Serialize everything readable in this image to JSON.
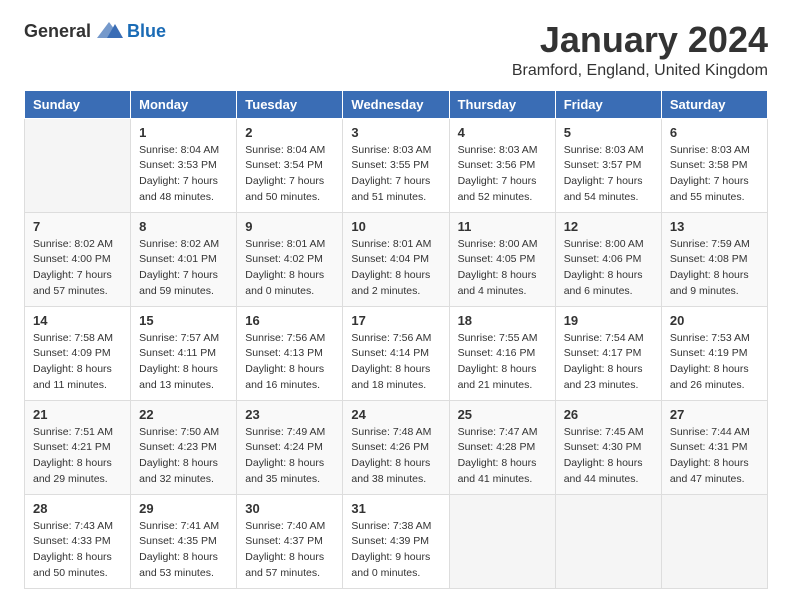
{
  "logo": {
    "text_general": "General",
    "text_blue": "Blue"
  },
  "title": {
    "month_year": "January 2024",
    "location": "Bramford, England, United Kingdom"
  },
  "days_of_week": [
    "Sunday",
    "Monday",
    "Tuesday",
    "Wednesday",
    "Thursday",
    "Friday",
    "Saturday"
  ],
  "weeks": [
    [
      {
        "day": "",
        "info": ""
      },
      {
        "day": "1",
        "info": "Sunrise: 8:04 AM\nSunset: 3:53 PM\nDaylight: 7 hours\nand 48 minutes."
      },
      {
        "day": "2",
        "info": "Sunrise: 8:04 AM\nSunset: 3:54 PM\nDaylight: 7 hours\nand 50 minutes."
      },
      {
        "day": "3",
        "info": "Sunrise: 8:03 AM\nSunset: 3:55 PM\nDaylight: 7 hours\nand 51 minutes."
      },
      {
        "day": "4",
        "info": "Sunrise: 8:03 AM\nSunset: 3:56 PM\nDaylight: 7 hours\nand 52 minutes."
      },
      {
        "day": "5",
        "info": "Sunrise: 8:03 AM\nSunset: 3:57 PM\nDaylight: 7 hours\nand 54 minutes."
      },
      {
        "day": "6",
        "info": "Sunrise: 8:03 AM\nSunset: 3:58 PM\nDaylight: 7 hours\nand 55 minutes."
      }
    ],
    [
      {
        "day": "7",
        "info": "Sunrise: 8:02 AM\nSunset: 4:00 PM\nDaylight: 7 hours\nand 57 minutes."
      },
      {
        "day": "8",
        "info": "Sunrise: 8:02 AM\nSunset: 4:01 PM\nDaylight: 7 hours\nand 59 minutes."
      },
      {
        "day": "9",
        "info": "Sunrise: 8:01 AM\nSunset: 4:02 PM\nDaylight: 8 hours\nand 0 minutes."
      },
      {
        "day": "10",
        "info": "Sunrise: 8:01 AM\nSunset: 4:04 PM\nDaylight: 8 hours\nand 2 minutes."
      },
      {
        "day": "11",
        "info": "Sunrise: 8:00 AM\nSunset: 4:05 PM\nDaylight: 8 hours\nand 4 minutes."
      },
      {
        "day": "12",
        "info": "Sunrise: 8:00 AM\nSunset: 4:06 PM\nDaylight: 8 hours\nand 6 minutes."
      },
      {
        "day": "13",
        "info": "Sunrise: 7:59 AM\nSunset: 4:08 PM\nDaylight: 8 hours\nand 9 minutes."
      }
    ],
    [
      {
        "day": "14",
        "info": "Sunrise: 7:58 AM\nSunset: 4:09 PM\nDaylight: 8 hours\nand 11 minutes."
      },
      {
        "day": "15",
        "info": "Sunrise: 7:57 AM\nSunset: 4:11 PM\nDaylight: 8 hours\nand 13 minutes."
      },
      {
        "day": "16",
        "info": "Sunrise: 7:56 AM\nSunset: 4:13 PM\nDaylight: 8 hours\nand 16 minutes."
      },
      {
        "day": "17",
        "info": "Sunrise: 7:56 AM\nSunset: 4:14 PM\nDaylight: 8 hours\nand 18 minutes."
      },
      {
        "day": "18",
        "info": "Sunrise: 7:55 AM\nSunset: 4:16 PM\nDaylight: 8 hours\nand 21 minutes."
      },
      {
        "day": "19",
        "info": "Sunrise: 7:54 AM\nSunset: 4:17 PM\nDaylight: 8 hours\nand 23 minutes."
      },
      {
        "day": "20",
        "info": "Sunrise: 7:53 AM\nSunset: 4:19 PM\nDaylight: 8 hours\nand 26 minutes."
      }
    ],
    [
      {
        "day": "21",
        "info": "Sunrise: 7:51 AM\nSunset: 4:21 PM\nDaylight: 8 hours\nand 29 minutes."
      },
      {
        "day": "22",
        "info": "Sunrise: 7:50 AM\nSunset: 4:23 PM\nDaylight: 8 hours\nand 32 minutes."
      },
      {
        "day": "23",
        "info": "Sunrise: 7:49 AM\nSunset: 4:24 PM\nDaylight: 8 hours\nand 35 minutes."
      },
      {
        "day": "24",
        "info": "Sunrise: 7:48 AM\nSunset: 4:26 PM\nDaylight: 8 hours\nand 38 minutes."
      },
      {
        "day": "25",
        "info": "Sunrise: 7:47 AM\nSunset: 4:28 PM\nDaylight: 8 hours\nand 41 minutes."
      },
      {
        "day": "26",
        "info": "Sunrise: 7:45 AM\nSunset: 4:30 PM\nDaylight: 8 hours\nand 44 minutes."
      },
      {
        "day": "27",
        "info": "Sunrise: 7:44 AM\nSunset: 4:31 PM\nDaylight: 8 hours\nand 47 minutes."
      }
    ],
    [
      {
        "day": "28",
        "info": "Sunrise: 7:43 AM\nSunset: 4:33 PM\nDaylight: 8 hours\nand 50 minutes."
      },
      {
        "day": "29",
        "info": "Sunrise: 7:41 AM\nSunset: 4:35 PM\nDaylight: 8 hours\nand 53 minutes."
      },
      {
        "day": "30",
        "info": "Sunrise: 7:40 AM\nSunset: 4:37 PM\nDaylight: 8 hours\nand 57 minutes."
      },
      {
        "day": "31",
        "info": "Sunrise: 7:38 AM\nSunset: 4:39 PM\nDaylight: 9 hours\nand 0 minutes."
      },
      {
        "day": "",
        "info": ""
      },
      {
        "day": "",
        "info": ""
      },
      {
        "day": "",
        "info": ""
      }
    ]
  ]
}
